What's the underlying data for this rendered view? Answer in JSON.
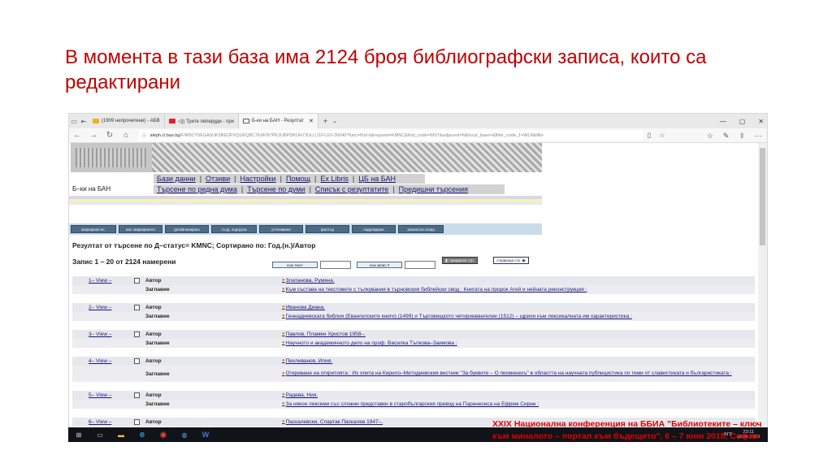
{
  "slide": {
    "title": "В момента в тази база има 2124 броя библиографски записа, които са редактирани",
    "footer": "XXIX Национална конференция на ББИА \"Библиотеките – ключ към миналото – портал към бъдещето\", 6 – 7 юни 2018, София"
  },
  "browser": {
    "tabs": [
      {
        "label": "(1909 непрочетени) - АБВ",
        "color": "#f2b01e"
      },
      {
        "label": "◁)) Трите пеперуди - при",
        "color": "#e8202a"
      },
      {
        "label": "Б-ки на БАН - Резултат",
        "color": "#555555"
      }
    ],
    "tab_close": "✕",
    "new_tab": "+",
    "url_host": "aleph.cl.bas.bg",
    "url_rest": "/F/M9CY5KGA5UK5BEDPXQUEQBC7E6KN7PK2UBPDKUH73ULLU1FLGV-30040?func=find-b&request=KMNC&find_code=WST&adjacent=N&local_base=&filter_code_1=WLN&filte",
    "win_controls": [
      "—",
      "▢",
      "✕"
    ]
  },
  "page": {
    "lib_name": "Б–ки на БАН",
    "menu1": [
      "Бази данни",
      "Отзиви",
      "Настройки",
      "Помощ",
      "Ex Libris",
      "ЦБ на БАН"
    ],
    "menu2": [
      "Търсене по редна дума",
      "Търсене по думи",
      "Списък с резултатите",
      "Предишни търсения"
    ],
    "toolbar": [
      "маркиране вс.",
      "изв. маркирането",
      "детайлизирано",
      "създ. подгрупа",
      "уточняване",
      "филтър",
      "подреждане",
      "запазв./ел.поща"
    ],
    "results_title": "Резултат от търсене по Д–статус= KMNC; Сортирано по: Год.(н.)/Автор",
    "records_line": "Запис 1 – 20 от 2124 намерени",
    "jump_text": "към текст",
    "jump_record": "към запис #",
    "prev_page": "предишна стр.",
    "next_page": "следваща стр.",
    "label_author": "Автор",
    "label_title": "Заглавие",
    "records": [
      {
        "link": "1– View –",
        "author": "Златанова, Румяна.",
        "title": "Към състава на текстовете с тълкувания в търновския библейски свод : Книгата на пророк Агей и нейната реконструкция :"
      },
      {
        "link": "2– View –",
        "author": "Иванова Диана.",
        "title": "Геннадиевската библия (Евангелските книги) (1499) и Търговищкото четириевангелие (1512) – щрихи към лексикалната им характеристика :"
      },
      {
        "link": "3– View –",
        "author": "Павлов, Пламен Христов 1958–.",
        "title": "Научното и академичното дело на проф. Василка Тъпкова–Заимова :"
      },
      {
        "link": "4– View –",
        "author": "Пехливанов, Илия.",
        "title": "Откриване на откритията : Из опита на Кирило–Методиевския вестник \"За буквите – О писменехъ\" в областта на научната публицистика по теми от славистиката и българистиката :"
      },
      {
        "link": "5– View –",
        "author": "Радева, Ния.",
        "title": "За някои лексеми със сложни представки в старобългарския превод на Паренесиса на Ефрем Сирин :"
      },
      {
        "link": "6– View –",
        "author": "Паскалевски, Спартак Паскалев 1947–.",
        "title": ""
      }
    ]
  },
  "taskbar": {
    "lang": "БГР",
    "time": "23:11",
    "date": "05.06.2018"
  }
}
